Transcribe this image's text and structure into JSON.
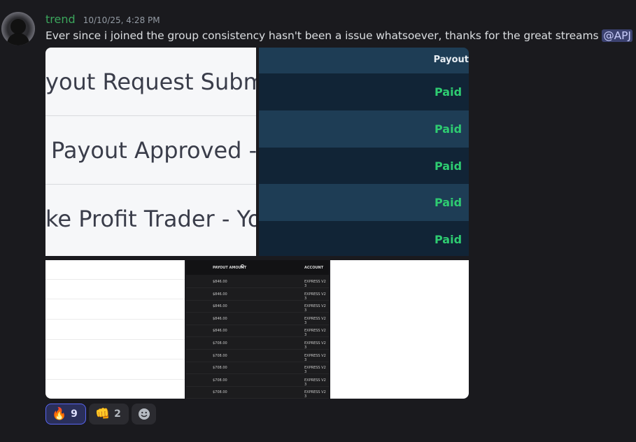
{
  "message": {
    "username": "trend",
    "timestamp": "10/10/25, 4:28 PM",
    "text": "Ever since i joined the group consistency hasn't been a issue whatsoever, thanks for the great streams ",
    "mention": "@APJ"
  },
  "attachments": {
    "email_subjects": [
      "yout Request Subm",
      "Payout Approved -",
      "ke Profit Trader - Yo"
    ],
    "payout_status": {
      "header": "Payout",
      "rows": [
        "Paid",
        "Paid",
        "Paid",
        "Paid",
        "Paid"
      ]
    },
    "payout_table": {
      "col_amount": "PAYOUT AMOUNT",
      "col_account": "ACCOUNT",
      "rows": [
        {
          "amount": "$846.00",
          "account": "EXPRESS V2 3"
        },
        {
          "amount": "$846.00",
          "account": "EXPRESS V2 3"
        },
        {
          "amount": "$846.00",
          "account": "EXPRESS V2 3"
        },
        {
          "amount": "$846.00",
          "account": "EXPRESS V2 3"
        },
        {
          "amount": "$846.00",
          "account": "EXPRESS V2 3"
        },
        {
          "amount": "$708.00",
          "account": "EXPRESS V2 3"
        },
        {
          "amount": "$708.00",
          "account": "EXPRESS V2 3"
        },
        {
          "amount": "$708.00",
          "account": "EXPRESS V2 3"
        },
        {
          "amount": "$708.00",
          "account": "EXPRESS V2 3"
        },
        {
          "amount": "$708.00",
          "account": "EXPRESS V2 3"
        }
      ]
    }
  },
  "reactions": [
    {
      "emoji": "🔥",
      "icon": "fire-icon",
      "count": "9",
      "active": true
    },
    {
      "emoji": "👊",
      "icon": "fist-bump-icon",
      "count": "2",
      "active": false
    }
  ],
  "add_reaction_icon": "smiley-icon",
  "colors": {
    "username": "#3ba55c",
    "paid": "#2ecc71",
    "mention_bg": "#3c4270",
    "accent": "#5865f2"
  }
}
